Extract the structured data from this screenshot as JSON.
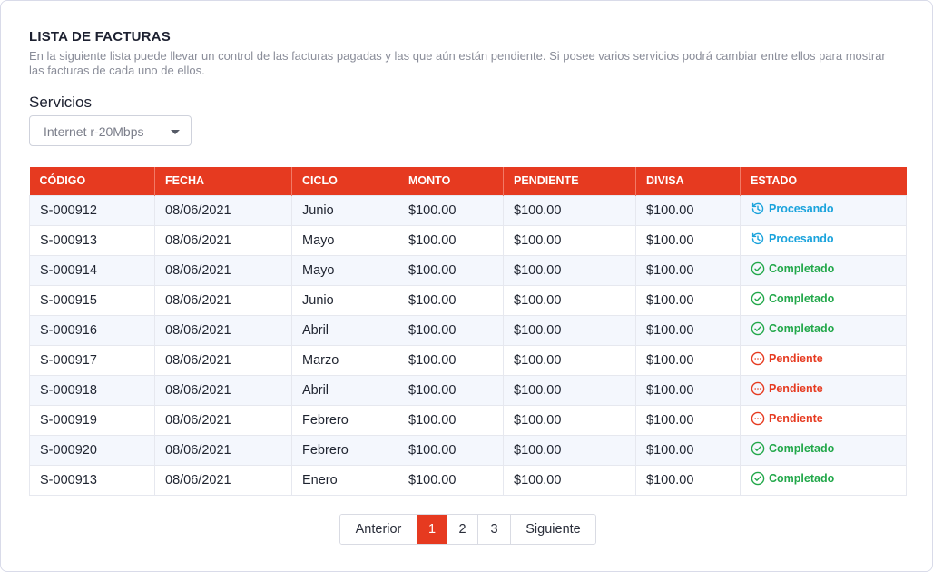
{
  "page": {
    "title": "LISTA DE FACTURAS",
    "description": "En la siguiente lista puede llevar un control de las facturas pagadas y las que aún están pendiente. Si posee varios servicios podrá cambiar entre ellos para mostrar las facturas de cada uno de ellos."
  },
  "services": {
    "label": "Servicios",
    "selected": "Internet r-20Mbps"
  },
  "table": {
    "headers": [
      "CÓDIGO",
      "FECHA",
      "CICLO",
      "MONTO",
      "PENDIENTE",
      "DIVISA",
      "ESTADO"
    ],
    "rows": [
      {
        "code": "S-000912",
        "date": "08/06/2021",
        "cycle": "Junio",
        "amount": "$100.00",
        "pending": "$100.00",
        "currency": "$100.00",
        "status": "Procesando",
        "status_type": "processing"
      },
      {
        "code": "S-000913",
        "date": "08/06/2021",
        "cycle": "Mayo",
        "amount": "$100.00",
        "pending": "$100.00",
        "currency": "$100.00",
        "status": "Procesando",
        "status_type": "processing"
      },
      {
        "code": "S-000914",
        "date": "08/06/2021",
        "cycle": "Mayo",
        "amount": "$100.00",
        "pending": "$100.00",
        "currency": "$100.00",
        "status": "Completado",
        "status_type": "completed"
      },
      {
        "code": "S-000915",
        "date": "08/06/2021",
        "cycle": "Junio",
        "amount": "$100.00",
        "pending": "$100.00",
        "currency": "$100.00",
        "status": "Completado",
        "status_type": "completed"
      },
      {
        "code": "S-000916",
        "date": "08/06/2021",
        "cycle": "Abril",
        "amount": "$100.00",
        "pending": "$100.00",
        "currency": "$100.00",
        "status": "Completado",
        "status_type": "completed"
      },
      {
        "code": "S-000917",
        "date": "08/06/2021",
        "cycle": "Marzo",
        "amount": "$100.00",
        "pending": "$100.00",
        "currency": "$100.00",
        "status": "Pendiente",
        "status_type": "pending"
      },
      {
        "code": "S-000918",
        "date": "08/06/2021",
        "cycle": "Abril",
        "amount": "$100.00",
        "pending": "$100.00",
        "currency": "$100.00",
        "status": "Pendiente",
        "status_type": "pending"
      },
      {
        "code": "S-000919",
        "date": "08/06/2021",
        "cycle": "Febrero",
        "amount": "$100.00",
        "pending": "$100.00",
        "currency": "$100.00",
        "status": "Pendiente",
        "status_type": "pending"
      },
      {
        "code": "S-000920",
        "date": "08/06/2021",
        "cycle": "Febrero",
        "amount": "$100.00",
        "pending": "$100.00",
        "currency": "$100.00",
        "status": "Completado",
        "status_type": "completed"
      },
      {
        "code": "S-000913",
        "date": "08/06/2021",
        "cycle": "Enero",
        "amount": "$100.00",
        "pending": "$100.00",
        "currency": "$100.00",
        "status": "Completado",
        "status_type": "completed"
      }
    ]
  },
  "status_icons": {
    "processing": "refresh-icon",
    "completed": "check-circle-icon",
    "pending": "more-circle-icon"
  },
  "colors": {
    "accent": "#e63a20",
    "processing": "#1aa3dc",
    "completed": "#22a84a",
    "pending": "#e63a20"
  },
  "pagination": {
    "prev_label": "Anterior",
    "pages": [
      "1",
      "2",
      "3"
    ],
    "active_page": "1",
    "next_label": "Siguiente"
  }
}
